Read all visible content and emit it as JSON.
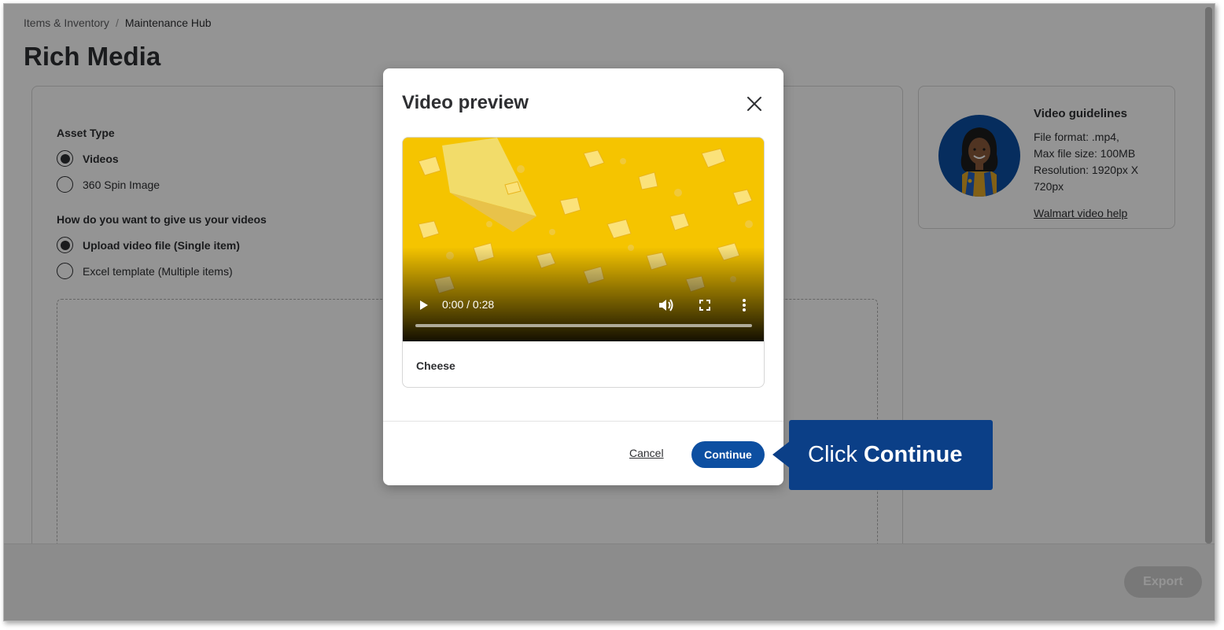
{
  "breadcrumb": {
    "parent": "Items & Inventory",
    "separator": "/",
    "current": "Maintenance Hub"
  },
  "page": {
    "title": "Rich Media"
  },
  "asset_type": {
    "label": "Asset Type",
    "options": [
      {
        "label": "Videos",
        "selected": true
      },
      {
        "label": "360 Spin Image",
        "selected": false
      }
    ]
  },
  "upload_method": {
    "label": "How do you want to give us your videos",
    "options": [
      {
        "label": "Upload video file (Single item)",
        "selected": true
      },
      {
        "label": "Excel template (Multiple items)",
        "selected": false
      }
    ]
  },
  "guidelines": {
    "title": "Video guidelines",
    "lines": [
      "File format: .mp4,",
      "Max file size: 100MB",
      "Resolution: 1920px X 720px"
    ],
    "link": "Walmart video help"
  },
  "footer": {
    "export_label": "Export"
  },
  "modal": {
    "title": "Video preview",
    "video": {
      "time": "0:00 / 0:28",
      "caption": "Cheese",
      "progress": 0
    },
    "cancel_label": "Cancel",
    "continue_label": "Continue"
  },
  "callout": {
    "prefix": "Click",
    "emphasis": "Continue"
  },
  "colors": {
    "brand_blue": "#0d4fa1",
    "callout_blue": "#0b3f87",
    "video_yellow": "#f5c400"
  }
}
